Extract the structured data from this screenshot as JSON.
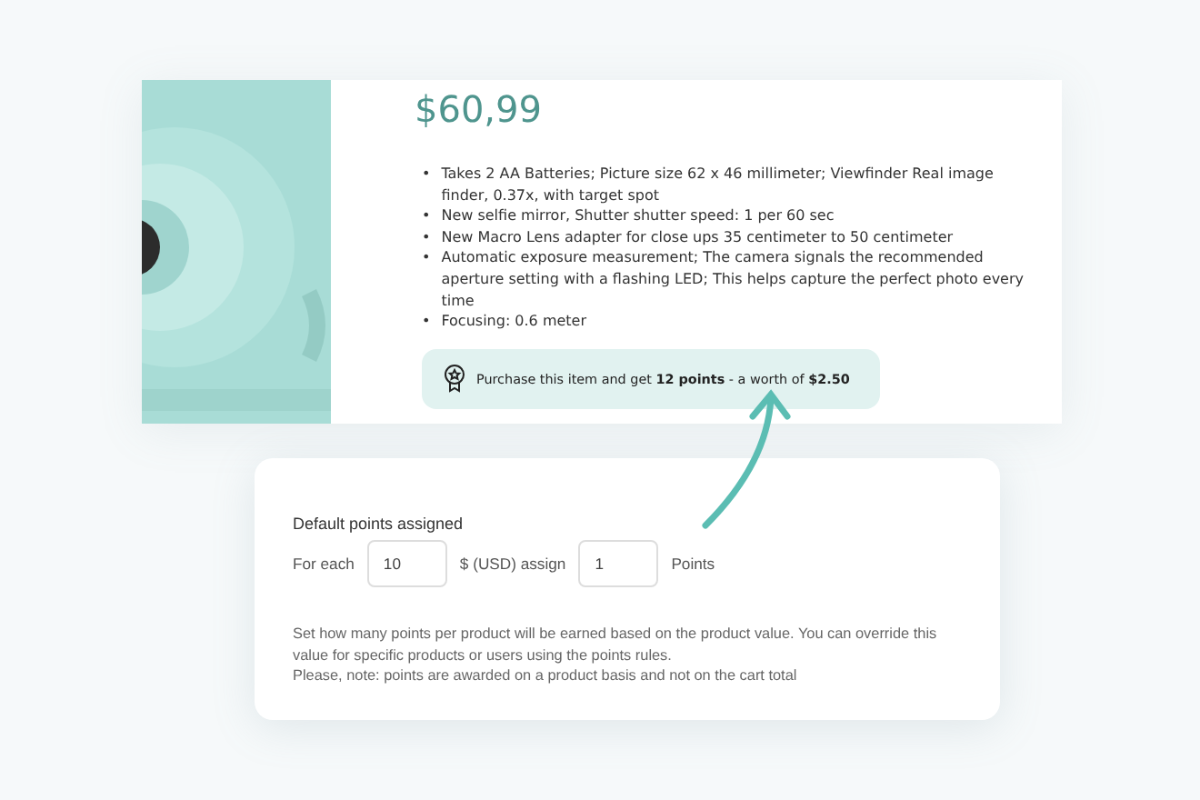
{
  "product": {
    "price": "$60,99",
    "features": [
      {
        "marker": "•",
        "text": "Takes 2 AA Batteries; Picture size 62 x 46 millimeter; Viewfinder Real image finder, 0.37x, with target spot"
      },
      {
        "marker": "•",
        "text": "New selfie mirror, Shutter shutter speed: 1 per 60 sec"
      },
      {
        "marker": "•",
        "text": "New Macro Lens adapter for close ups 35 centimeter to 50 centimeter"
      },
      {
        "marker": "•",
        "text": "Automatic exposure measurement; The camera signals the recommended aperture setting with a flashing LED; This helps capture the perfect photo every time"
      },
      {
        "marker": "•",
        "text": "Focusing: 0.6 meter"
      }
    ],
    "points_banner": "Purchase this item and get **12 points** - a worth of **$2.50**"
  },
  "settings": {
    "title": "Default points assigned",
    "for_each_label": "For each",
    "amount": "10",
    "currency_label": "$ (USD) assign",
    "points": "1",
    "points_label": "Points",
    "help": [
      "Set how many points per product will be earned based on the product value. You can override this value for specific products or users using the points rules.",
      "Please, note: points are awarded on a product basis and not on the cart total"
    ]
  }
}
